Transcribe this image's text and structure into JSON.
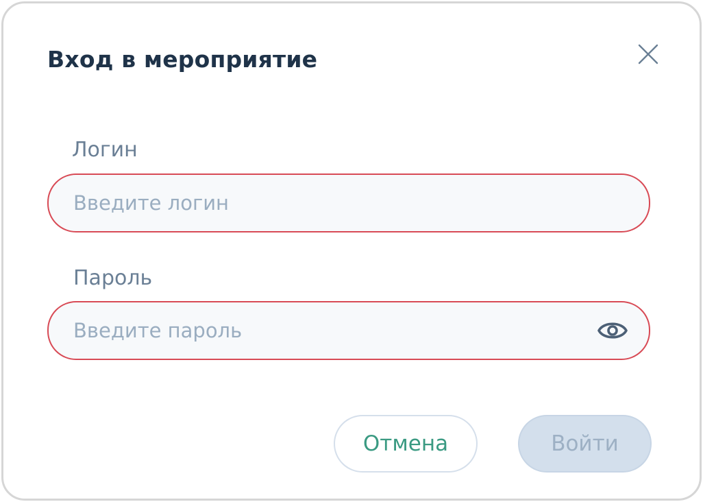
{
  "dialog": {
    "title": "Вход в мероприятие"
  },
  "login": {
    "label": "Логин",
    "placeholder": "Введите логин",
    "value": ""
  },
  "password": {
    "label": "Пароль",
    "placeholder": "Введите пароль",
    "value": ""
  },
  "buttons": {
    "cancel_label": "Отмена",
    "submit_label": "Войти"
  },
  "colors": {
    "title": "#1f3349",
    "label": "#6a7f95",
    "error_border": "#d84a55",
    "cancel_text": "#3a9a82",
    "submit_disabled_bg": "#d3dfec"
  },
  "icons": {
    "close": "close-icon",
    "show_password": "eye-icon"
  }
}
